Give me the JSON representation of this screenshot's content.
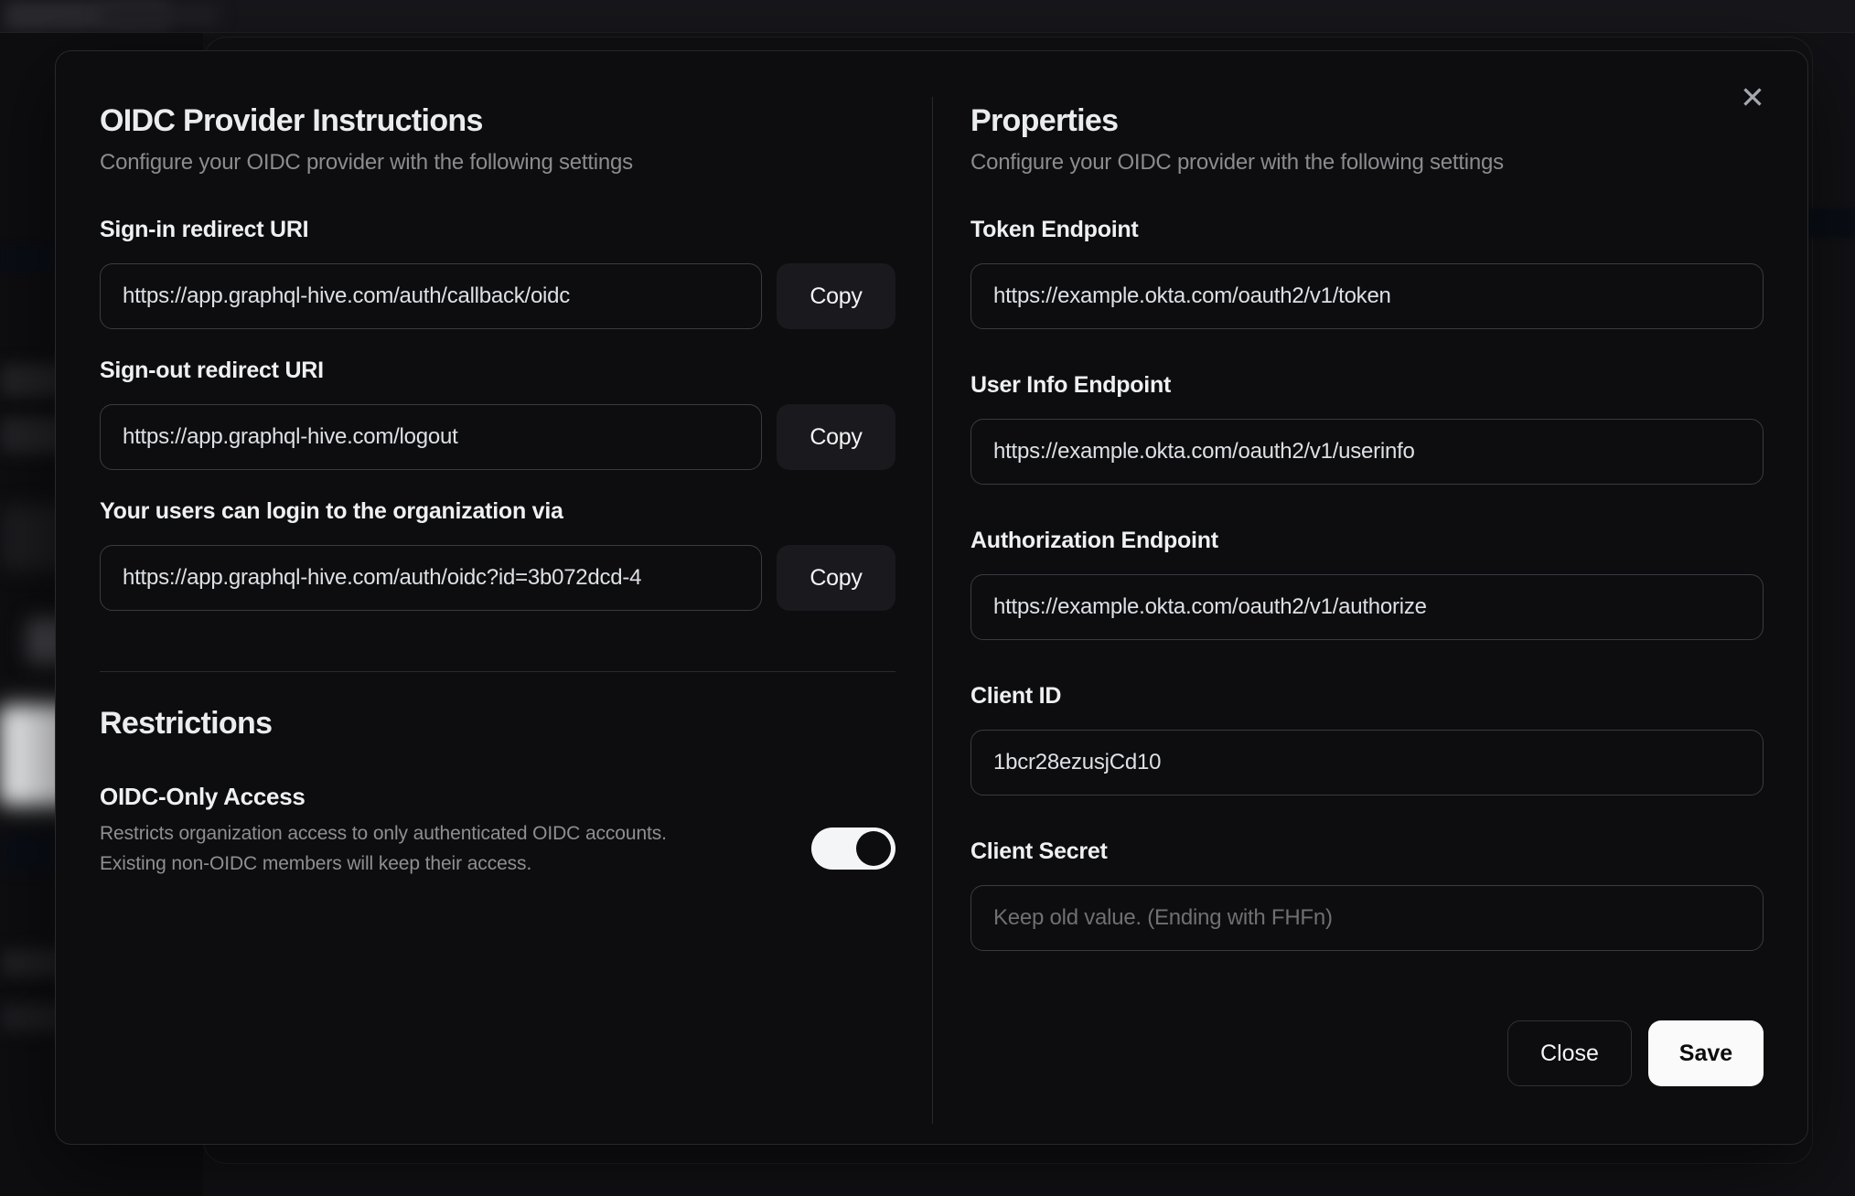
{
  "modal": {
    "close_icon": "✕",
    "left_panel": {
      "title": "OIDC Provider Instructions",
      "subtitle": "Configure your OIDC provider with the following settings",
      "fields": [
        {
          "label": "Sign-in redirect URI",
          "value": "https://app.graphql-hive.com/auth/callback/oidc",
          "copy_label": "Copy"
        },
        {
          "label": "Sign-out redirect URI",
          "value": "https://app.graphql-hive.com/logout",
          "copy_label": "Copy"
        },
        {
          "label": "Your users can login to the organization via",
          "value": "https://app.graphql-hive.com/auth/oidc?id=3b072dcd-4",
          "copy_label": "Copy"
        }
      ],
      "restrictions": {
        "title": "Restrictions",
        "toggle_label": "OIDC-Only Access",
        "toggle_description": "Restricts organization access to only authenticated OIDC accounts. Existing non-OIDC members will keep their access.",
        "toggle_state": "on"
      }
    },
    "right_panel": {
      "title": "Properties",
      "subtitle": "Configure your OIDC provider with the following settings",
      "fields": [
        {
          "label": "Token Endpoint",
          "value": "https://example.okta.com/oauth2/v1/token"
        },
        {
          "label": "User Info Endpoint",
          "value": "https://example.okta.com/oauth2/v1/userinfo"
        },
        {
          "label": "Authorization Endpoint",
          "value": "https://example.okta.com/oauth2/v1/authorize"
        },
        {
          "label": "Client ID",
          "value": "1bcr28ezusjCd10"
        },
        {
          "label": "Client Secret",
          "value": "",
          "placeholder": "Keep old value. (Ending with FHFn)"
        }
      ],
      "buttons": {
        "close_label": "Close",
        "save_label": "Save"
      }
    }
  },
  "colors": {
    "page_background": "#121216",
    "modal_background": "#0d0d10",
    "input_border": "#3a3a40",
    "accent_button": "#fafafa",
    "toggle_on": "#f4f5f6",
    "text_primary": "#ebecee",
    "text_secondary": "#8b8b90"
  }
}
